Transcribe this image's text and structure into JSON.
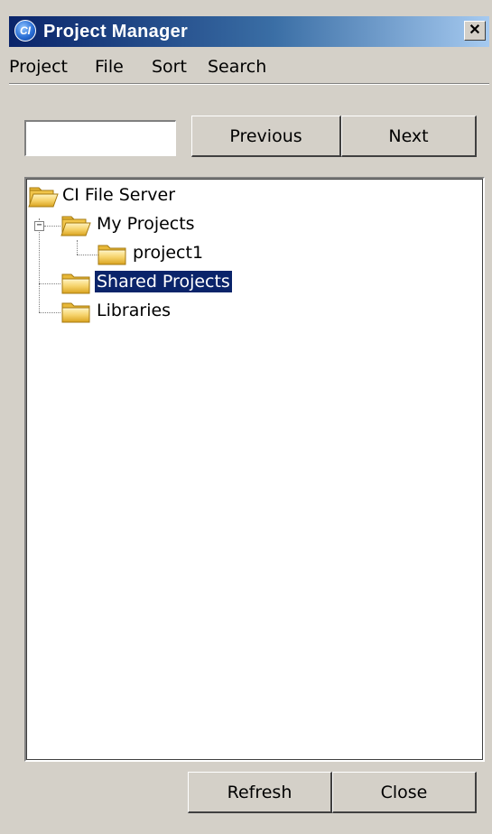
{
  "window": {
    "title": "Project Manager",
    "icon_text": "CI",
    "close_glyph": "✕"
  },
  "menu": [
    "Project",
    "File",
    "Sort",
    "Search"
  ],
  "search": {
    "value": "",
    "placeholder": "",
    "previous_label": "Previous",
    "next_label": "Next"
  },
  "tree": {
    "root": "CI File Server",
    "my_projects": "My Projects",
    "project1": "project1",
    "shared_projects": "Shared Projects",
    "libraries": "Libraries",
    "expander_symbol": "−",
    "selected": "Shared Projects"
  },
  "footer": {
    "refresh_label": "Refresh",
    "close_label": "Close"
  },
  "icons": {
    "folder-icon": "folder",
    "open-folder-icon": "open-folder"
  },
  "colors": {
    "titlebar_start": "#0a246a",
    "titlebar_end": "#a6caf0",
    "selection": "#0a246a",
    "face": "#d4d0c8",
    "folder": "#f3c84a"
  }
}
